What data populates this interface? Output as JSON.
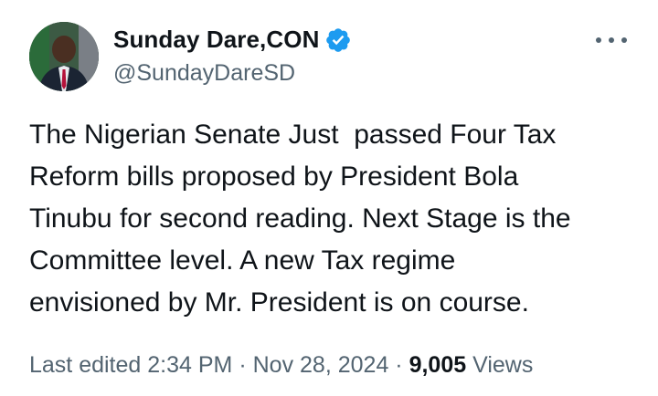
{
  "author": {
    "display_name": "Sunday Dare,CON",
    "handle": "@SundayDareSD",
    "verified_icon": "verified-badge-icon",
    "avatar_icon": "profile-photo"
  },
  "menu": {
    "icon": "more-options-icon"
  },
  "tweet": {
    "text": "The Nigerian Senate Just  passed Four Tax\nReform bills proposed by President Bola\nTinubu for second reading. Next Stage is the\nCommittee level. A new Tax regime\nenvisioned by Mr. President is on course."
  },
  "meta": {
    "edited_label": "Last edited",
    "time": "2:34 PM",
    "separator": "·",
    "date": "Nov 28, 2024",
    "views_count": "9,005",
    "views_label": "Views"
  },
  "colors": {
    "text_primary": "#0f1419",
    "text_secondary": "#536471",
    "verified_blue": "#1d9bf0"
  }
}
